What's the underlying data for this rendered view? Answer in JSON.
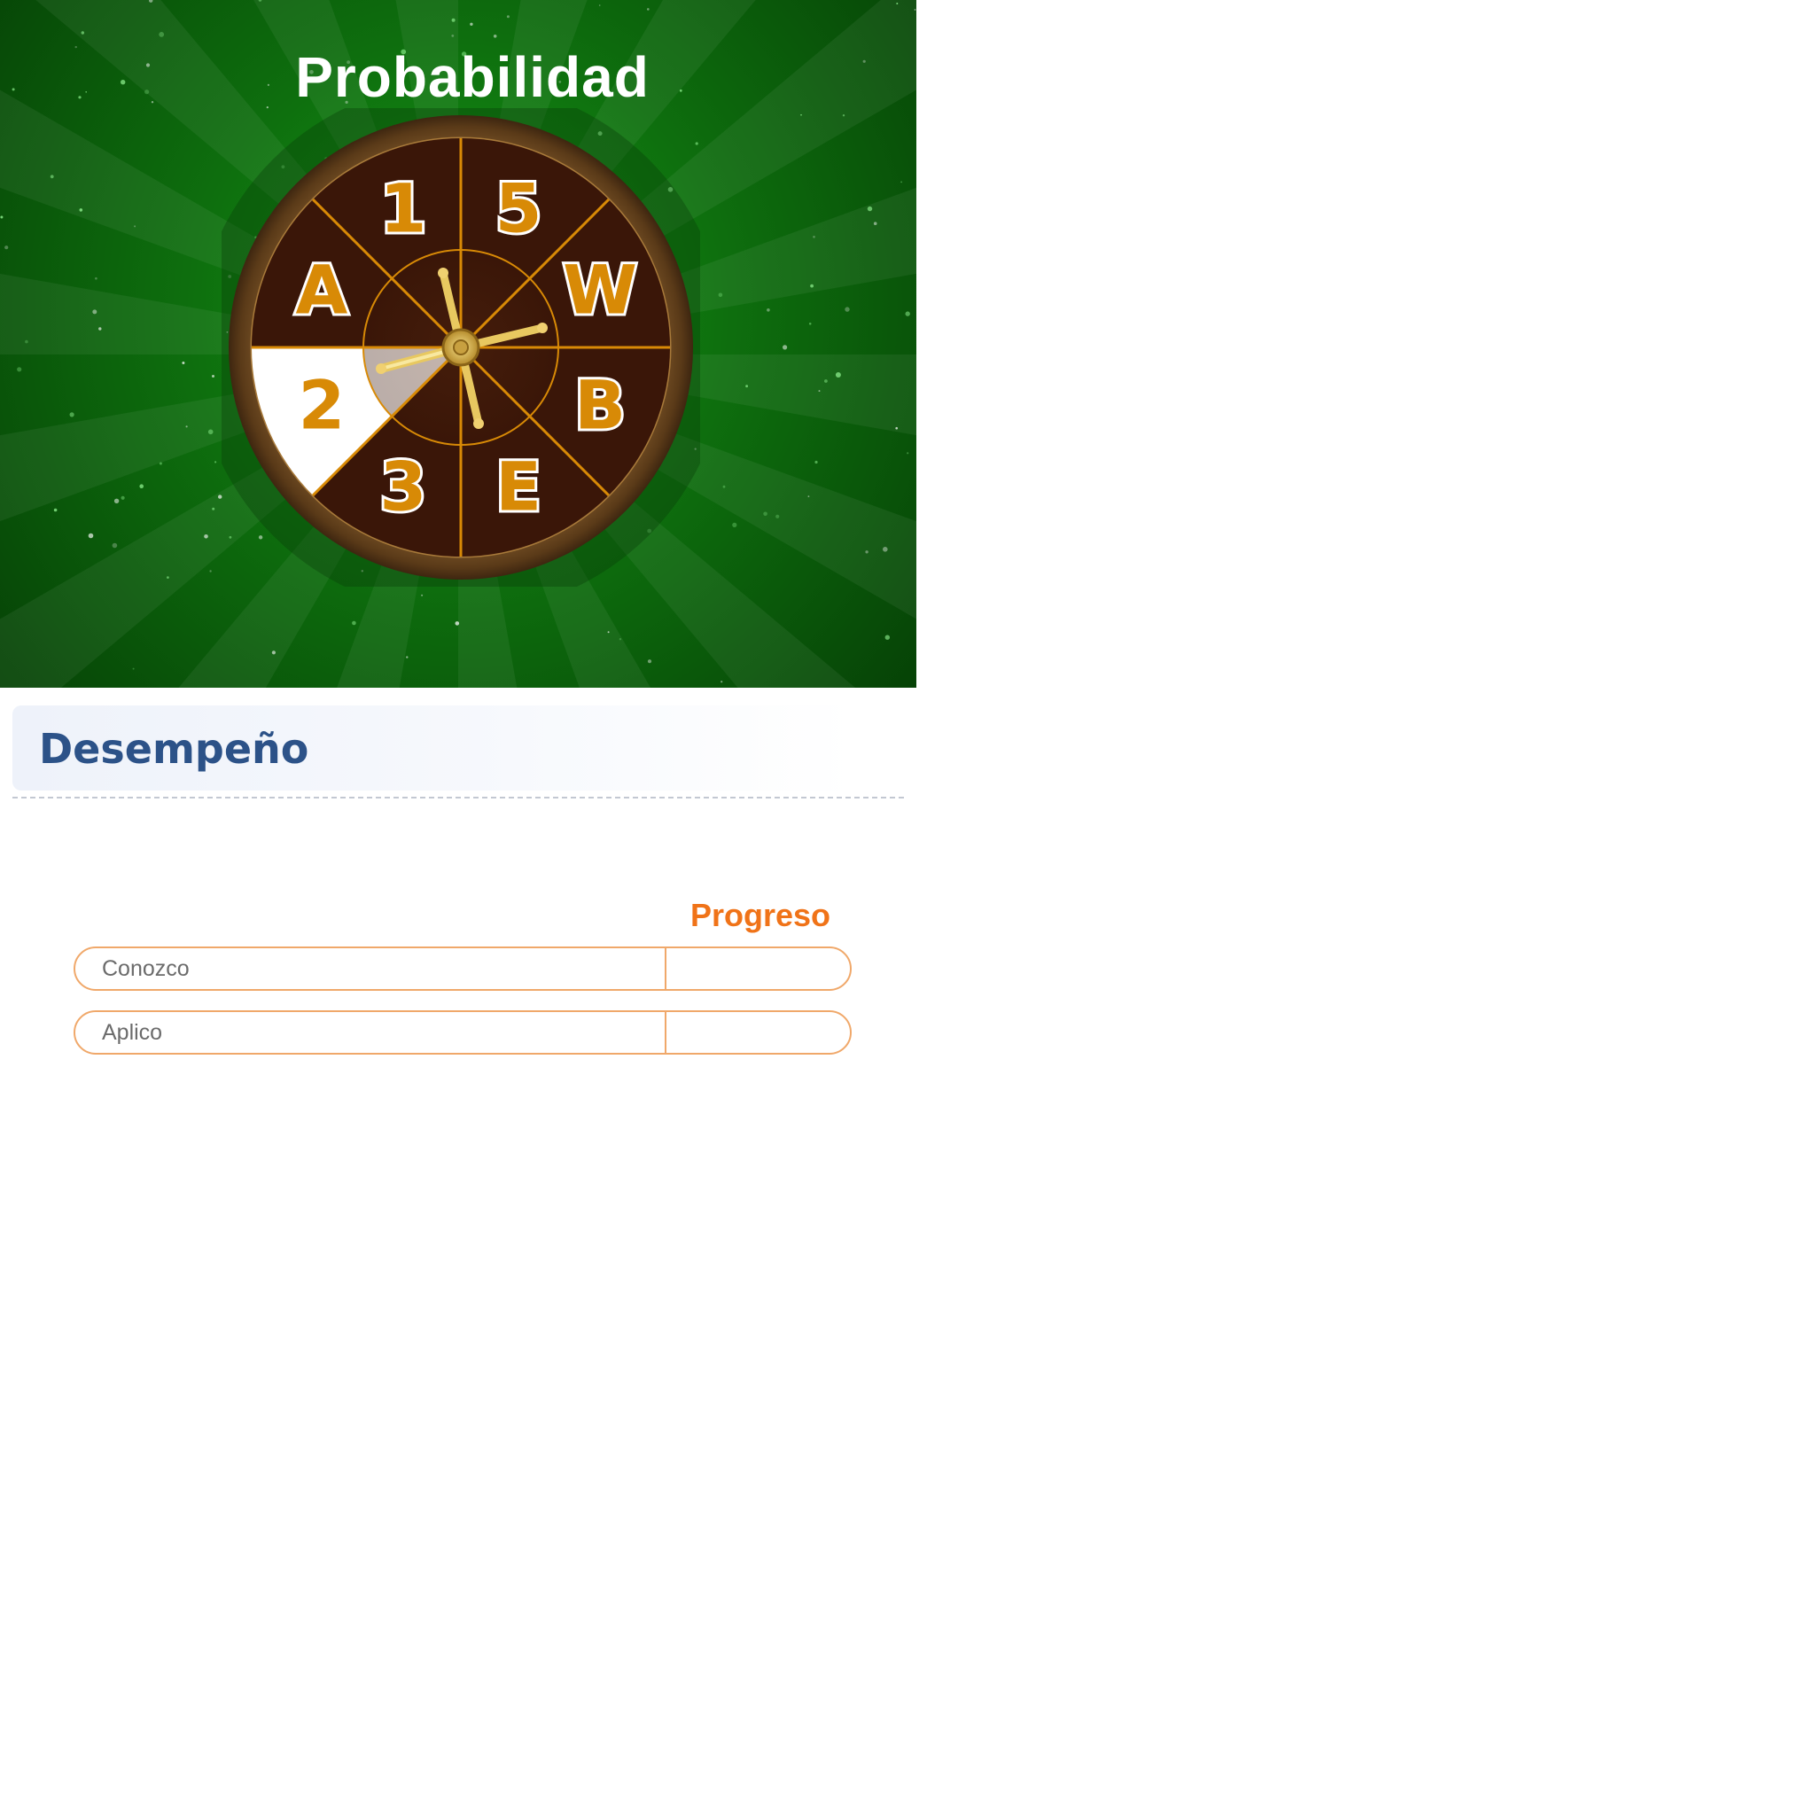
{
  "banner": {
    "title": "Probabilidad",
    "wheel": {
      "segments": [
        "5",
        "W",
        "B",
        "E",
        "3",
        "2",
        "A",
        "1"
      ],
      "highlighted": "2",
      "colors": {
        "segment": "#3a1608",
        "highlight": "#ffffff",
        "rim": "#6b4a22",
        "label": "#d88a06"
      }
    }
  },
  "section": {
    "title": "Desempeño"
  },
  "performance": {
    "progress_header": "Progreso",
    "rows": [
      {
        "label": "Conozco",
        "progress": ""
      },
      {
        "label": "Aplico",
        "progress": ""
      }
    ]
  }
}
